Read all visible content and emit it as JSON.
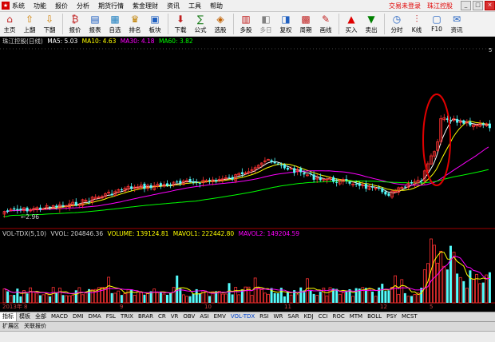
{
  "menu": {
    "items": [
      "系统",
      "功能",
      "报价",
      "分析",
      "期货行情",
      "紫金理财",
      "资讯",
      "工具",
      "帮助"
    ],
    "login_text": "交易未登录",
    "stock_name": "珠江控股",
    "win_buttons": [
      "_",
      "□",
      "×"
    ]
  },
  "toolbar": {
    "buttons": [
      {
        "label": "主页",
        "icon": "home-icon",
        "glyph": "⌂"
      },
      {
        "label": "上翻",
        "icon": "page-up-icon",
        "glyph": "⇧"
      },
      {
        "label": "下翻",
        "icon": "page-down-icon",
        "glyph": "⇩"
      },
      {
        "label": "报价",
        "icon": "quote-icon",
        "glyph": "₿"
      },
      {
        "label": "报表",
        "icon": "report-icon",
        "glyph": "▤"
      },
      {
        "label": "自选",
        "icon": "favorites-icon",
        "glyph": "▦"
      },
      {
        "label": "排名",
        "icon": "ranking-icon",
        "glyph": "♛"
      },
      {
        "label": "板块",
        "icon": "sector-icon",
        "glyph": "▣"
      },
      {
        "label": "下载",
        "icon": "download-icon",
        "glyph": "⬇"
      },
      {
        "label": "公式",
        "icon": "formula-icon",
        "glyph": "∑"
      },
      {
        "label": "选股",
        "icon": "stock-picker-icon",
        "glyph": "◈"
      },
      {
        "label": "多股",
        "icon": "multi-stock-icon",
        "glyph": "▥"
      },
      {
        "label": "多日",
        "icon": "multi-day-icon",
        "glyph": "◧"
      },
      {
        "label": "复权",
        "icon": "adjust-icon",
        "glyph": "◨"
      },
      {
        "label": "周期",
        "icon": "period-icon",
        "glyph": "▩"
      },
      {
        "label": "画线",
        "icon": "draw-line-icon",
        "glyph": "✎"
      },
      {
        "label": "买入",
        "icon": "buy-icon",
        "glyph": "▲"
      },
      {
        "label": "卖出",
        "icon": "sell-icon",
        "glyph": "▼"
      },
      {
        "label": "分时",
        "icon": "intraday-icon",
        "glyph": "◷"
      },
      {
        "label": "K线",
        "icon": "kline-icon",
        "glyph": "⫶"
      },
      {
        "label": "F10",
        "icon": "f10-icon",
        "glyph": "▢"
      },
      {
        "label": "资讯",
        "icon": "news-icon",
        "glyph": "✉"
      }
    ]
  },
  "price_legend": {
    "title": "珠江控股(日线)",
    "ma5": "MA5: 5.03",
    "ma10": "MA10: 4.63",
    "ma30": "MA30: 4.18",
    "ma60": "MA60: 3.82"
  },
  "volume_legend": {
    "title": "VOL-TDX(5,10)",
    "vvol": "VVOL: 204846.36",
    "volume": "VOLUME: 139124.81",
    "mavol1": "MAVOL1: 222442.80",
    "mavol2": "MAVOL2: 149204.59"
  },
  "chart": {
    "low_label": "2.96",
    "right_marker": "5",
    "date_labels": [
      "2013年 8",
      "9",
      "10",
      "11",
      "12",
      "5"
    ]
  },
  "indicator_tabs": [
    "指标",
    "模板",
    "全部",
    "MACD",
    "DMI",
    "DMA",
    "FSL",
    "TRIX",
    "BRAR",
    "CR",
    "VR",
    "OBV",
    "ASI",
    "EMV",
    "VOL-TDX",
    "RSI",
    "WR",
    "SAR",
    "KDJ",
    "CCI",
    "ROC",
    "MTM",
    "BOLL",
    "PSY",
    "MCST"
  ],
  "bottom_tabs": [
    "扩展区",
    "关联报价"
  ],
  "colors": {
    "up": "#ff3232",
    "down": "#54fcfc",
    "ma5": "#ffffff",
    "ma10": "#ffff00",
    "ma30": "#ff00ff",
    "ma60": "#00ff00",
    "annotation": "#e00000",
    "axis": "#a00000"
  }
}
